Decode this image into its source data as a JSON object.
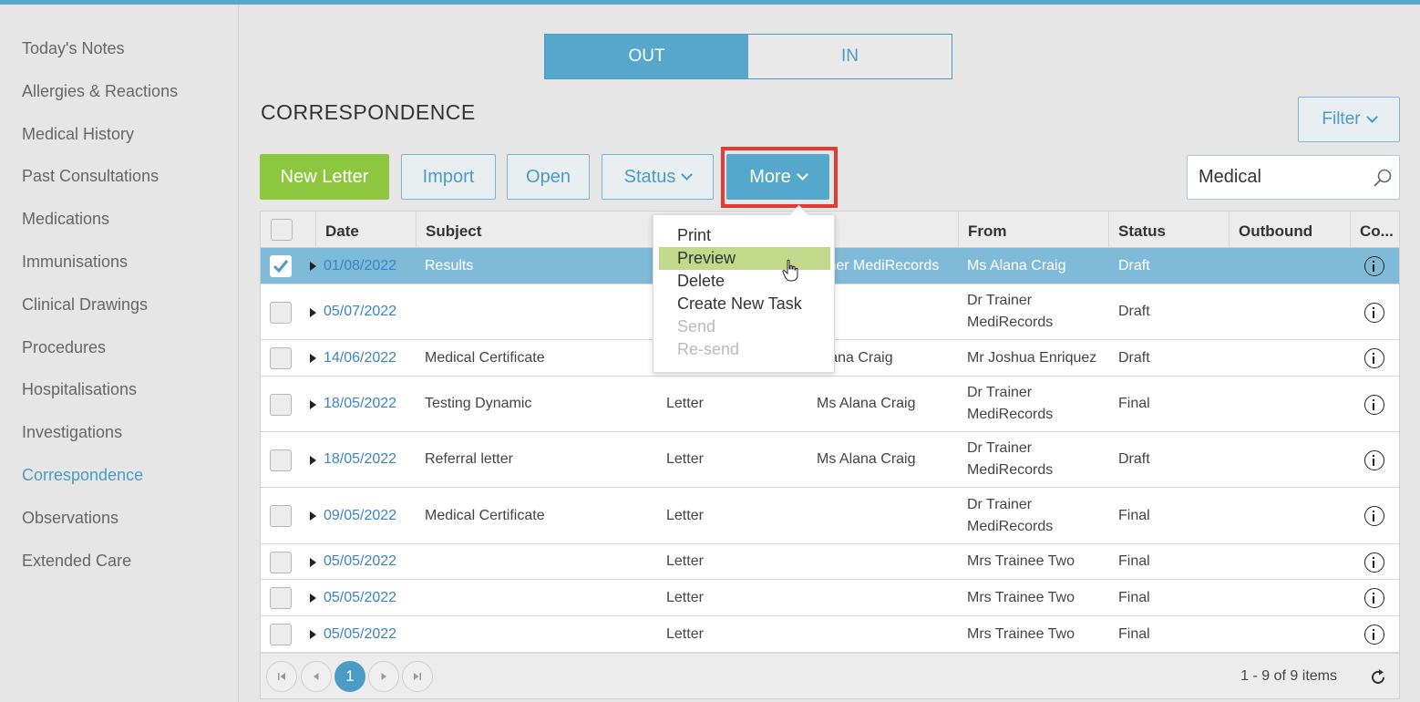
{
  "sidebar": {
    "items": [
      {
        "label": "Today's Notes"
      },
      {
        "label": "Allergies & Reactions"
      },
      {
        "label": "Medical History"
      },
      {
        "label": "Past Consultations"
      },
      {
        "label": "Medications"
      },
      {
        "label": "Immunisations"
      },
      {
        "label": "Clinical Drawings"
      },
      {
        "label": "Procedures"
      },
      {
        "label": "Hospitalisations"
      },
      {
        "label": "Investigations"
      },
      {
        "label": "Correspondence",
        "active": true
      },
      {
        "label": "Observations"
      },
      {
        "label": "Extended Care"
      }
    ]
  },
  "toggle": {
    "out": "OUT",
    "in": "IN",
    "selected": "OUT"
  },
  "page_title": "CORRESPONDENCE",
  "toolbar": {
    "new_letter": "New Letter",
    "import": "Import",
    "open": "Open",
    "status": "Status",
    "more": "More",
    "filter": "Filter"
  },
  "search": {
    "value": "Medical"
  },
  "table": {
    "columns": [
      "Date",
      "Subject",
      "",
      "",
      "From",
      "Status",
      "Outbound",
      "Co..."
    ],
    "rows": [
      {
        "date": "01/08/2022",
        "subject": "Results",
        "type": "",
        "to": "ainer MediRecords",
        "from1": "Ms Alana Craig",
        "from2": "",
        "status": "Draft",
        "selected": true
      },
      {
        "date": "05/07/2022",
        "subject": "",
        "type": "",
        "to": "",
        "from1": "Dr Trainer",
        "from2": "MediRecords",
        "status": "Draft"
      },
      {
        "date": "14/06/2022",
        "subject": "Medical Certificate",
        "type": "",
        "to": "Alana Craig",
        "from1": "Mr Joshua Enriquez",
        "from2": "",
        "status": "Draft"
      },
      {
        "date": "18/05/2022",
        "subject": "Testing Dynamic",
        "type": "Letter",
        "to": "Ms Alana Craig",
        "from1": "Dr Trainer",
        "from2": "MediRecords",
        "status": "Final"
      },
      {
        "date": "18/05/2022",
        "subject": "Referral letter",
        "type": "Letter",
        "to": "Ms Alana Craig",
        "from1": "Dr Trainer",
        "from2": "MediRecords",
        "status": "Draft"
      },
      {
        "date": "09/05/2022",
        "subject": "Medical Certificate",
        "type": "Letter",
        "to": "",
        "from1": "Dr Trainer",
        "from2": "MediRecords",
        "status": "Final"
      },
      {
        "date": "05/05/2022",
        "subject": "",
        "type": "Letter",
        "to": "",
        "from1": "Mrs Trainee Two",
        "from2": "",
        "status": "Final"
      },
      {
        "date": "05/05/2022",
        "subject": "",
        "type": "Letter",
        "to": "",
        "from1": "Mrs Trainee Two",
        "from2": "",
        "status": "Final"
      },
      {
        "date": "05/05/2022",
        "subject": "",
        "type": "Letter",
        "to": "",
        "from1": "Mrs Trainee Two",
        "from2": "",
        "status": "Final"
      }
    ]
  },
  "pager": {
    "current": "1",
    "summary": "1 - 9 of 9 items"
  },
  "more_menu": {
    "items": [
      {
        "label": "Print"
      },
      {
        "label": "Preview",
        "hover": true
      },
      {
        "label": "Delete"
      },
      {
        "label": "Create New Task"
      },
      {
        "label": "Send",
        "disabled": true
      },
      {
        "label": "Re-send",
        "disabled": true
      }
    ]
  },
  "colors": {
    "accent": "#4a9cc5",
    "green": "#8dc63f",
    "selected_row": "#7fbbd8",
    "highlight": "#e53935"
  }
}
